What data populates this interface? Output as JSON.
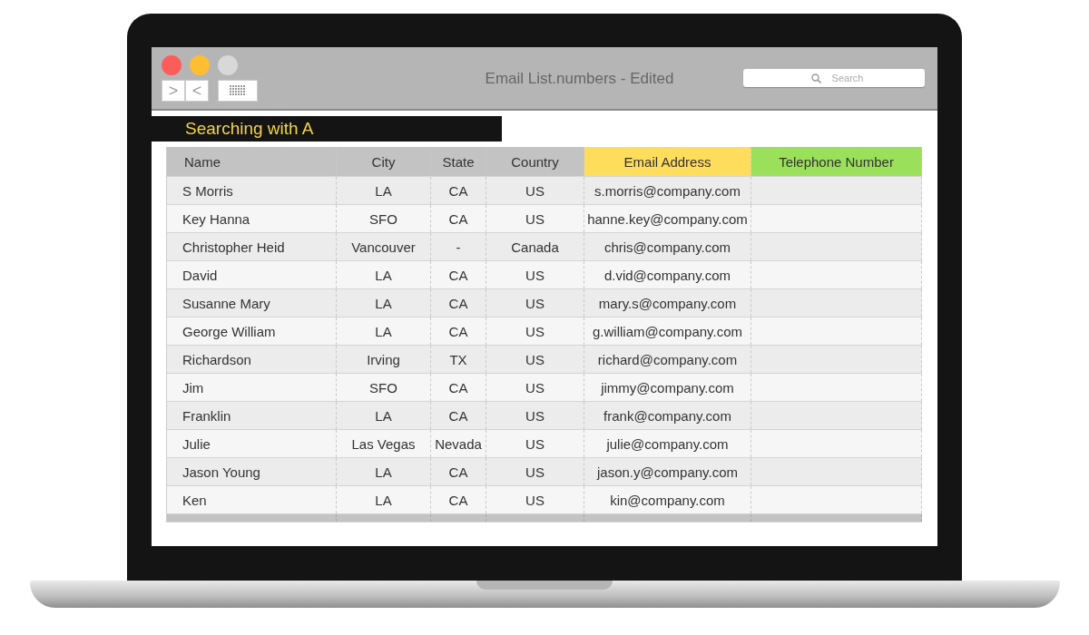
{
  "window": {
    "title": "Email List.numbers - Edited"
  },
  "toolbar": {
    "forward": ">",
    "back": "<"
  },
  "search": {
    "placeholder": "Search"
  },
  "banner": "Searching with A",
  "table": {
    "columns": [
      {
        "label": "Name",
        "color": "#c2c3c2"
      },
      {
        "label": "City",
        "color": "#c2c3c2"
      },
      {
        "label": "State",
        "color": "#c2c3c2"
      },
      {
        "label": "Country",
        "color": "#c2c3c2"
      },
      {
        "label": "Email Address",
        "color": "#ffdd5c"
      },
      {
        "label": "Telephone Number",
        "color": "#9be05a"
      }
    ],
    "rows": [
      [
        "S Morris",
        "LA",
        "CA",
        "US",
        "s.morris@company.com"
      ],
      [
        "Key Hanna",
        "SFO",
        "CA",
        "US",
        "hanne.key@company.com"
      ],
      [
        "Christopher Heid",
        "Vancouver",
        "-",
        "Canada",
        "chris@company.com"
      ],
      [
        "David",
        "LA",
        "CA",
        "US",
        "d.vid@company.com"
      ],
      [
        "Susanne Mary",
        "LA",
        "CA",
        "US",
        "mary.s@company.com"
      ],
      [
        "George William",
        "LA",
        "CA",
        "US",
        "g.william@company.com"
      ],
      [
        "Richardson",
        "Irving",
        "TX",
        "US",
        "richard@company.com"
      ],
      [
        "Jim",
        "SFO",
        "CA",
        "US",
        "jimmy@company.com"
      ],
      [
        "Franklin",
        "LA",
        "CA",
        "US",
        "frank@company.com"
      ],
      [
        "Julie",
        "Las Vegas",
        "Nevada",
        "US",
        "julie@company.com"
      ],
      [
        "Jason Young",
        "LA",
        "CA",
        "US",
        "jason.y@company.com"
      ],
      [
        "Ken",
        "LA",
        "CA",
        "US",
        "kin@company.com"
      ]
    ]
  }
}
